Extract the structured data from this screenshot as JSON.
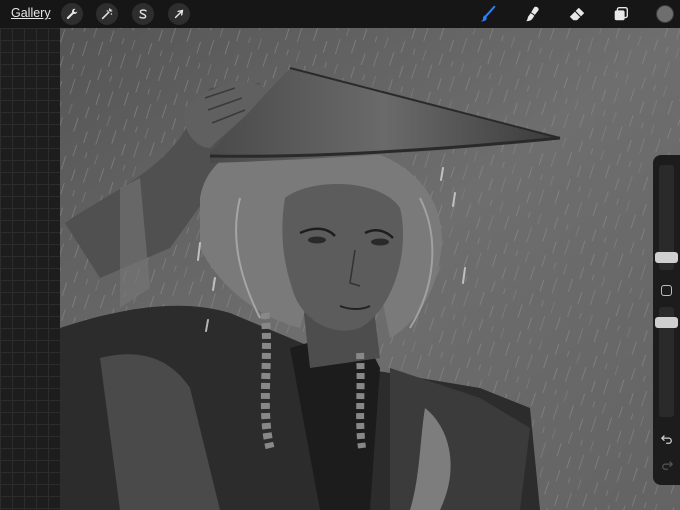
{
  "topbar": {
    "gallery_label": "Gallery",
    "left_tools": [
      {
        "name": "actions",
        "icon": "wrench-icon"
      },
      {
        "name": "adjustments",
        "icon": "magic-wand-icon"
      },
      {
        "name": "selection",
        "icon": "selection-s-icon"
      },
      {
        "name": "transform",
        "icon": "arrow-cursor-icon"
      }
    ],
    "right_tools": [
      {
        "name": "brush",
        "icon": "brush-icon",
        "active": true,
        "color": "#2f7ff5"
      },
      {
        "name": "smudge",
        "icon": "smudge-icon"
      },
      {
        "name": "eraser",
        "icon": "eraser-icon"
      },
      {
        "name": "layers",
        "icon": "layers-icon"
      }
    ],
    "current_color": "#6e6e6e"
  },
  "canvas": {
    "artwork": "grayscale-drawing-figure-in-conical-hat-in-rain"
  },
  "sidebar": {
    "brush_size_icon": "size-slider-knob",
    "modify_icon": "square-icon",
    "opacity_icon": "opacity-slider-knob",
    "undo_icon": "undo-arrow-icon",
    "redo_icon": "redo-arrow-icon"
  }
}
